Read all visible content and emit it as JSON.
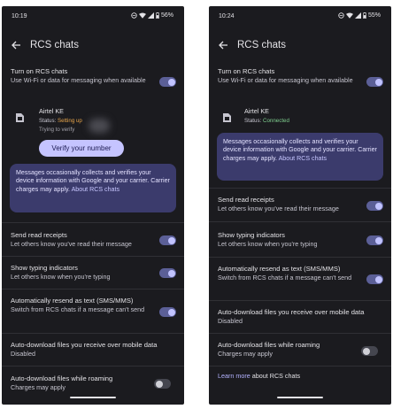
{
  "left": {
    "time": "10:19",
    "battery": "56%",
    "title": "RCS chats",
    "turn_on": {
      "title": "Turn on RCS chats",
      "subtitle": "Use Wi-Fi or data for messaging when available"
    },
    "carrier": {
      "name": "Airtel KE",
      "status_label": "Status:",
      "status_value": "Setting up",
      "trying": "Trying to verify"
    },
    "verify_button": "Verify your number",
    "info": {
      "text": "Messages occasionally collects and verifies your device information with Google and your carrier. Carrier charges may apply.",
      "link": "About RCS chats"
    },
    "read_receipts": {
      "title": "Send read receipts",
      "subtitle": "Let others know you've read their message"
    },
    "typing": {
      "title": "Show typing indicators",
      "subtitle": "Let others know when you're typing"
    },
    "resend": {
      "title": "Automatically resend as text (SMS/MMS)",
      "subtitle": "Switch from RCS chats if a message can't send"
    },
    "auto_download_data": {
      "title": "Auto-download files you receive over mobile data",
      "subtitle": "Disabled"
    },
    "auto_download_roaming": {
      "title": "Auto-download files while roaming",
      "subtitle": "Charges may apply"
    }
  },
  "right": {
    "time": "10:24",
    "battery": "55%",
    "title": "RCS chats",
    "turn_on": {
      "title": "Turn on RCS chats",
      "subtitle": "Use Wi-Fi or data for messaging when available"
    },
    "carrier": {
      "name": "Airtel KE",
      "status_label": "Status:",
      "status_value": "Connected"
    },
    "info": {
      "text": "Messages occasionally collects and verifies your device information with Google and your carrier. Carrier charges may apply.",
      "link": "About RCS chats"
    },
    "read_receipts": {
      "title": "Send read receipts",
      "subtitle": "Let others know you've read their message"
    },
    "typing": {
      "title": "Show typing indicators",
      "subtitle": "Let others know when you're typing"
    },
    "resend": {
      "title": "Automatically resend as text (SMS/MMS)",
      "subtitle": "Switch from RCS chats if a message can't send"
    },
    "auto_download_data": {
      "title": "Auto-download files you receive over mobile data",
      "subtitle": "Disabled"
    },
    "auto_download_roaming": {
      "title": "Auto-download files while roaming",
      "subtitle": "Charges may apply"
    },
    "learn_more": {
      "link": "Learn more",
      "text": "about RCS chats"
    }
  },
  "icons": [
    "dnd-icon",
    "wifi-icon",
    "signal-icon",
    "battery-icon",
    "back-arrow-icon",
    "sim-card-icon"
  ],
  "colors": {
    "background": "#1b1b1f",
    "accent": "#c5c4ff",
    "toggle_on": "#5b5f97",
    "info_box": "#3b3b6c",
    "status_warning": "#e9a64b",
    "status_ok": "#7fcf8f"
  }
}
